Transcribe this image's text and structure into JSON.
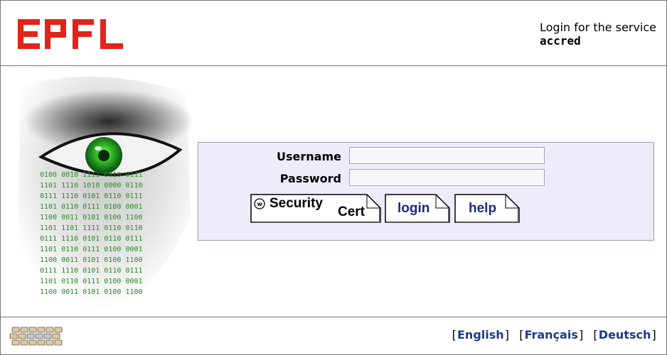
{
  "header": {
    "logo_text": "EPFL",
    "service_prefix": "Login for the service",
    "service_name": "accred",
    "brand_color": "#e2231a"
  },
  "form": {
    "username_label": "Username",
    "password_label": "Password",
    "username_value": "",
    "password_value": ""
  },
  "buttons": {
    "security_word": "Security",
    "cert_word": "Cert",
    "login_label": "login",
    "help_label": "help"
  },
  "eye_binary": [
    "0100 0010 1111 0010 0111",
    "1101 1110 1010 0000 0110",
    "0111 1110 0101 0110 0111",
    "1101 0110 0111 0100 0001",
    "1100 0011 0101 0100 1100",
    "1101 1101 1111 0110 0110",
    "0111 1110 0101 0110 0111",
    "1101 0110 0111 0100 0001",
    "1100 0011 0101 0100 1100",
    "0111 1110 0101 0110 0111",
    "1101 0110 0111 0100 0001",
    "1100 0011 0101 0100 1100"
  ],
  "footer": {
    "languages": [
      "English",
      "Français",
      "Deutsch"
    ]
  }
}
